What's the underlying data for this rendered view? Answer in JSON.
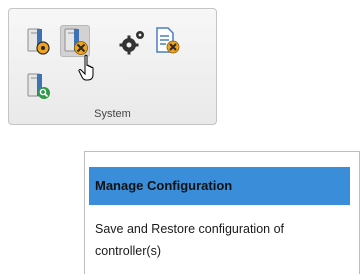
{
  "ribbon": {
    "group_label": "System",
    "icons": [
      {
        "name": "server-settings-icon",
        "hovered": false
      },
      {
        "name": "manage-configuration-icon",
        "hovered": true
      },
      {
        "name": "settings-gears-icon",
        "hovered": false
      },
      {
        "name": "edit-document-icon",
        "hovered": false
      },
      {
        "name": "server-search-icon",
        "hovered": false
      }
    ]
  },
  "tooltip": {
    "title": "Manage Configuration",
    "description": "Save and Restore configuration of controller(s)"
  },
  "colors": {
    "tooltip_header": "#3a8dd8",
    "icon_blue": "#3d73b4",
    "icon_orange": "#f0a31e",
    "icon_green": "#2e9a45"
  }
}
